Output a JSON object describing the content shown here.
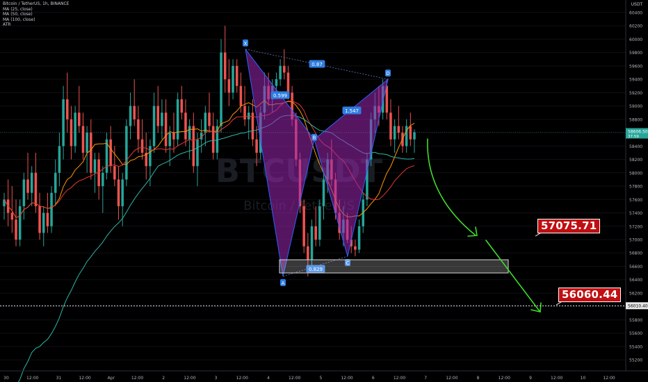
{
  "legend": {
    "title": "Bitcoin / TetherUS, 1h, BINANCE",
    "ma25": "MA (25, close)",
    "ma50": "MA (50, close)",
    "ma100": "MA (100, close)",
    "atr": "ATR"
  },
  "watermark": {
    "symbol": "BTCUSDT",
    "sub": "Bitcoin / TetherUS"
  },
  "currency": "USDT",
  "price_axis": {
    "ticks": [
      "60400",
      "60200",
      "60000",
      "59800",
      "59600",
      "59400",
      "59200",
      "59000",
      "58800",
      "58600",
      "58400",
      "58200",
      "58000",
      "57800",
      "57600",
      "57400",
      "57200",
      "57000",
      "56800",
      "56600",
      "56400",
      "56200",
      "56000",
      "55800",
      "55600",
      "55400",
      "55200"
    ],
    "current_price": "58606.50",
    "countdown": "37:59",
    "line_price": "56010.40"
  },
  "time_axis": [
    "30",
    "12:00",
    "31",
    "12:00",
    "Apr",
    "12:00",
    "2",
    "12:00",
    "3",
    "12:00",
    "4",
    "12:00",
    "5",
    "12:00",
    "6",
    "12:00",
    "7",
    "12:00",
    "8",
    "12:00",
    "9",
    "12:00",
    "10",
    "12:00"
  ],
  "pattern": {
    "points": [
      {
        "label": "X",
        "price": 59850
      },
      {
        "label": "A",
        "price": 56450
      },
      {
        "label": "B",
        "price": 58500
      },
      {
        "label": "C",
        "price": 56750
      },
      {
        "label": "D",
        "price": 59400
      }
    ],
    "ratios": [
      {
        "label": "0.87"
      },
      {
        "label": "0.599"
      },
      {
        "label": "1.547"
      },
      {
        "label": "0.829"
      }
    ]
  },
  "targets": {
    "t1": "57075.71",
    "t2": "56060.44"
  },
  "colors": {
    "up": "#26a69a",
    "down": "#ef5350",
    "ma25": "#ff9800",
    "ma50": "#e53935",
    "ma100": "#2fb5a6",
    "pattern_fill": "#9c27b0",
    "pattern_line": "#2962ff",
    "arrow": "#3fdc2a",
    "callout": "#c00f12"
  },
  "chart_data": {
    "type": "candlestick",
    "candles": [
      [
        57500,
        57700,
        57300,
        57600
      ],
      [
        57600,
        57900,
        57200,
        57400
      ],
      [
        57400,
        57800,
        57100,
        57300
      ],
      [
        57300,
        57600,
        56900,
        57000
      ],
      [
        57000,
        57600,
        56900,
        57500
      ],
      [
        57500,
        58000,
        57300,
        57900
      ],
      [
        57900,
        58300,
        57600,
        57700
      ],
      [
        57700,
        58100,
        57500,
        58000
      ],
      [
        58000,
        58300,
        57400,
        57500
      ],
      [
        57500,
        57700,
        57000,
        57100
      ],
      [
        57100,
        57500,
        56900,
        57400
      ],
      [
        57400,
        57700,
        57100,
        57200
      ],
      [
        57200,
        57800,
        57100,
        57700
      ],
      [
        57700,
        58200,
        57500,
        58000
      ],
      [
        58000,
        58600,
        57800,
        58400
      ],
      [
        58400,
        59300,
        58200,
        59100
      ],
      [
        59100,
        59500,
        58600,
        58800
      ],
      [
        58800,
        59000,
        58200,
        58400
      ],
      [
        58400,
        59000,
        58300,
        58900
      ],
      [
        58900,
        59300,
        58600,
        58700
      ],
      [
        58700,
        58900,
        58200,
        58300
      ],
      [
        58300,
        58700,
        58000,
        58600
      ],
      [
        58600,
        58800,
        57900,
        58000
      ],
      [
        58000,
        58300,
        57700,
        58200
      ],
      [
        58200,
        58300,
        57600,
        57800
      ],
      [
        57800,
        58100,
        57400,
        58000
      ],
      [
        58000,
        58600,
        57900,
        58500
      ],
      [
        58500,
        58700,
        58000,
        58100
      ],
      [
        58100,
        58400,
        57800,
        57900
      ],
      [
        57900,
        58100,
        57300,
        57500
      ],
      [
        57500,
        58000,
        57200,
        57900
      ],
      [
        57900,
        58800,
        57800,
        58700
      ],
      [
        58700,
        59200,
        58500,
        59000
      ],
      [
        59000,
        59400,
        58700,
        58800
      ],
      [
        58800,
        59000,
        58300,
        58500
      ],
      [
        58500,
        58800,
        58200,
        58300
      ],
      [
        58300,
        58600,
        57900,
        58100
      ],
      [
        58100,
        58500,
        57800,
        58400
      ],
      [
        58400,
        59200,
        58300,
        59000
      ],
      [
        59000,
        59300,
        58600,
        58700
      ],
      [
        58700,
        59100,
        58500,
        58900
      ],
      [
        58900,
        59100,
        58300,
        58400
      ],
      [
        58400,
        58700,
        58100,
        58600
      ],
      [
        58600,
        58900,
        58300,
        58500
      ],
      [
        58500,
        59200,
        58400,
        59100
      ],
      [
        59100,
        59300,
        58800,
        58900
      ],
      [
        58900,
        59100,
        58400,
        58500
      ],
      [
        58500,
        58800,
        58200,
        58700
      ],
      [
        58700,
        58900,
        58000,
        58100
      ],
      [
        58100,
        58600,
        57800,
        58500
      ],
      [
        58500,
        58800,
        58300,
        58600
      ],
      [
        58600,
        59000,
        58400,
        58900
      ],
      [
        58900,
        59200,
        58600,
        58700
      ],
      [
        58700,
        58900,
        58200,
        58300
      ],
      [
        58300,
        58800,
        58200,
        58700
      ],
      [
        58700,
        60000,
        58600,
        59800
      ],
      [
        59800,
        60200,
        59200,
        59400
      ],
      [
        59400,
        59700,
        59000,
        59200
      ],
      [
        59200,
        59700,
        59100,
        59600
      ],
      [
        59600,
        59700,
        59200,
        59300
      ],
      [
        59300,
        59500,
        58900,
        59000
      ],
      [
        59000,
        59300,
        58700,
        58800
      ],
      [
        58800,
        59000,
        58500,
        58900
      ],
      [
        58900,
        59100,
        58400,
        58500
      ],
      [
        58500,
        58700,
        58100,
        58300
      ],
      [
        58300,
        59000,
        58200,
        58900
      ],
      [
        58900,
        59500,
        58800,
        59300
      ],
      [
        59300,
        59500,
        59000,
        59100
      ],
      [
        59100,
        59400,
        58900,
        59300
      ],
      [
        59300,
        59500,
        59100,
        59400
      ],
      [
        59400,
        59700,
        59300,
        59600
      ],
      [
        59600,
        59850,
        59400,
        59500
      ],
      [
        59500,
        59600,
        59100,
        59200
      ],
      [
        59200,
        59300,
        58700,
        58800
      ],
      [
        58800,
        58900,
        58100,
        58200
      ],
      [
        58200,
        58300,
        57400,
        57500
      ],
      [
        57500,
        57600,
        56800,
        56900
      ],
      [
        56900,
        57100,
        56450,
        56700
      ],
      [
        56700,
        57300,
        56600,
        57200
      ],
      [
        57200,
        57500,
        56900,
        57000
      ],
      [
        57000,
        57600,
        56900,
        57500
      ],
      [
        57500,
        58000,
        57300,
        57900
      ],
      [
        57900,
        58300,
        57700,
        58200
      ],
      [
        58200,
        58500,
        57800,
        57900
      ],
      [
        57900,
        58000,
        57300,
        57400
      ],
      [
        57400,
        57600,
        57000,
        57100
      ],
      [
        57100,
        57500,
        56900,
        57300
      ],
      [
        57300,
        57400,
        56950,
        57000
      ],
      [
        57000,
        57200,
        56800,
        56900
      ],
      [
        56900,
        57000,
        56750,
        56850
      ],
      [
        56850,
        57300,
        56800,
        57200
      ],
      [
        57200,
        57700,
        57100,
        57600
      ],
      [
        57600,
        58300,
        57500,
        58200
      ],
      [
        58200,
        58900,
        58100,
        58800
      ],
      [
        58800,
        59200,
        58600,
        59000
      ],
      [
        59000,
        59300,
        58700,
        58900
      ],
      [
        58900,
        59400,
        58800,
        59300
      ],
      [
        59300,
        59400,
        58800,
        58900
      ],
      [
        58900,
        59100,
        58400,
        58500
      ],
      [
        58500,
        58800,
        58300,
        58700
      ],
      [
        58700,
        59000,
        58500,
        58600
      ],
      [
        58600,
        58700,
        58300,
        58400
      ],
      [
        58400,
        58800,
        58300,
        58700
      ],
      [
        58700,
        58900,
        58400,
        58500
      ],
      [
        58500,
        58650,
        58300,
        58606.5
      ]
    ]
  }
}
